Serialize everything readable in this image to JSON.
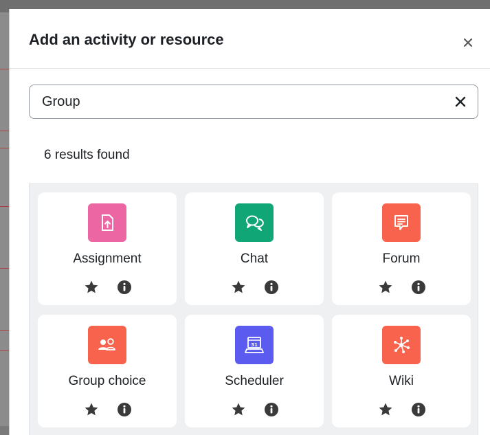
{
  "modal": {
    "title": "Add an activity or resource",
    "close_label": "×"
  },
  "search": {
    "value": "Group",
    "placeholder": "Search"
  },
  "results": {
    "count_text": "6 results found"
  },
  "activities": [
    {
      "label": "Assignment",
      "icon": "assignment-icon",
      "color": "#eb66a2"
    },
    {
      "label": "Chat",
      "icon": "chat-icon",
      "color": "#11a676"
    },
    {
      "label": "Forum",
      "icon": "forum-icon",
      "color": "#f7634d"
    },
    {
      "label": "Group choice",
      "icon": "group-choice-icon",
      "color": "#f7634d"
    },
    {
      "label": "Scheduler",
      "icon": "scheduler-icon",
      "color": "#5b5bf0"
    },
    {
      "label": "Wiki",
      "icon": "wiki-icon",
      "color": "#f7634d"
    }
  ],
  "colors": {
    "text": "#1d2125",
    "action_icon": "#3a3a3a",
    "panel": "#eef0f2"
  }
}
